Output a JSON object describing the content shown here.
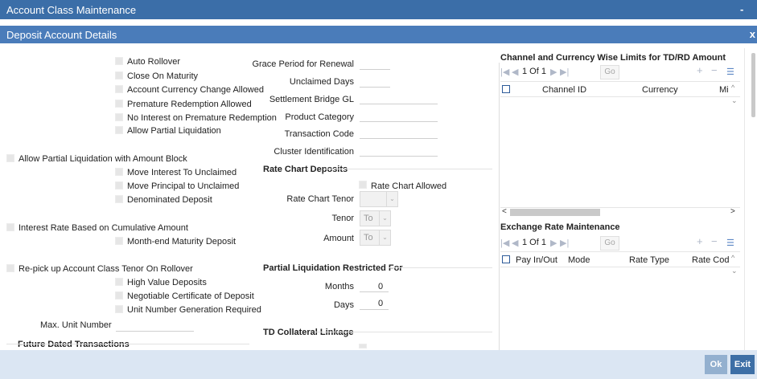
{
  "window": {
    "title": "Account Class Maintenance",
    "minimize": "-",
    "close": "x"
  },
  "panel": {
    "title": "Deposit Account Details",
    "close": "x"
  },
  "left": {
    "options1": [
      "Auto Rollover",
      "Close On Maturity",
      "Account Currency Change Allowed",
      "Premature Redemption Allowed",
      "No Interest on Premature Redemption",
      "Allow Partial Liquidation"
    ],
    "amount_block": "Allow Partial Liquidation with Amount Block",
    "options2": [
      "Move Interest To Unclaimed",
      "Move Principal to Unclaimed",
      "Denominated Deposit"
    ],
    "cumulative": "Interest Rate Based on Cumulative Amount",
    "month_end": "Month-end Maturity Deposit",
    "repick": "Re-pick up Account Class Tenor On Rollover",
    "options3": [
      "High Value Deposits",
      "Negotiable Certificate of Deposit",
      "Unit Number Generation Required"
    ],
    "max_unit_label": "Max. Unit Number",
    "future_dated": "Future Dated Transactions"
  },
  "middle": {
    "fields": [
      "Grace Period for Renewal",
      "Unclaimed Days",
      "Settlement Bridge GL",
      "Product Category",
      "Transaction Code",
      "Cluster Identification"
    ],
    "rate_chart_section": "Rate Chart Deposits",
    "rate_chart_allowed": "Rate Chart Allowed",
    "rate_chart_tenor": "Rate Chart Tenor",
    "tenor_label": "Tenor",
    "tenor_value": "To",
    "amount_label": "Amount",
    "amount_value": "To",
    "partial_section": "Partial Liquidation Restricted For",
    "months_label": "Months",
    "months_value": "0",
    "days_label": "Days",
    "days_value": "0",
    "td_section": "TD Collateral Linkage"
  },
  "right": {
    "channel": {
      "title": "Channel and Currency Wise Limits for TD/RD Amount",
      "pager": "1 Of 1",
      "go": "Go",
      "columns": [
        "Channel ID",
        "Currency",
        "Mi"
      ]
    },
    "exchange": {
      "title": "Exchange Rate Maintenance",
      "pager": "1 Of 1",
      "go": "Go",
      "columns": [
        "Pay In/Out",
        "Mode",
        "Rate Type",
        "Rate Code"
      ]
    }
  },
  "footer": {
    "ok": "Ok",
    "exit": "Exit"
  },
  "colors": {
    "title_bar": "#3b6ea8",
    "panel_bar": "#4a7cba",
    "footer": "#dbe6f3",
    "ok_button": "#93b0cf",
    "exit_button": "#3d6fa6"
  }
}
